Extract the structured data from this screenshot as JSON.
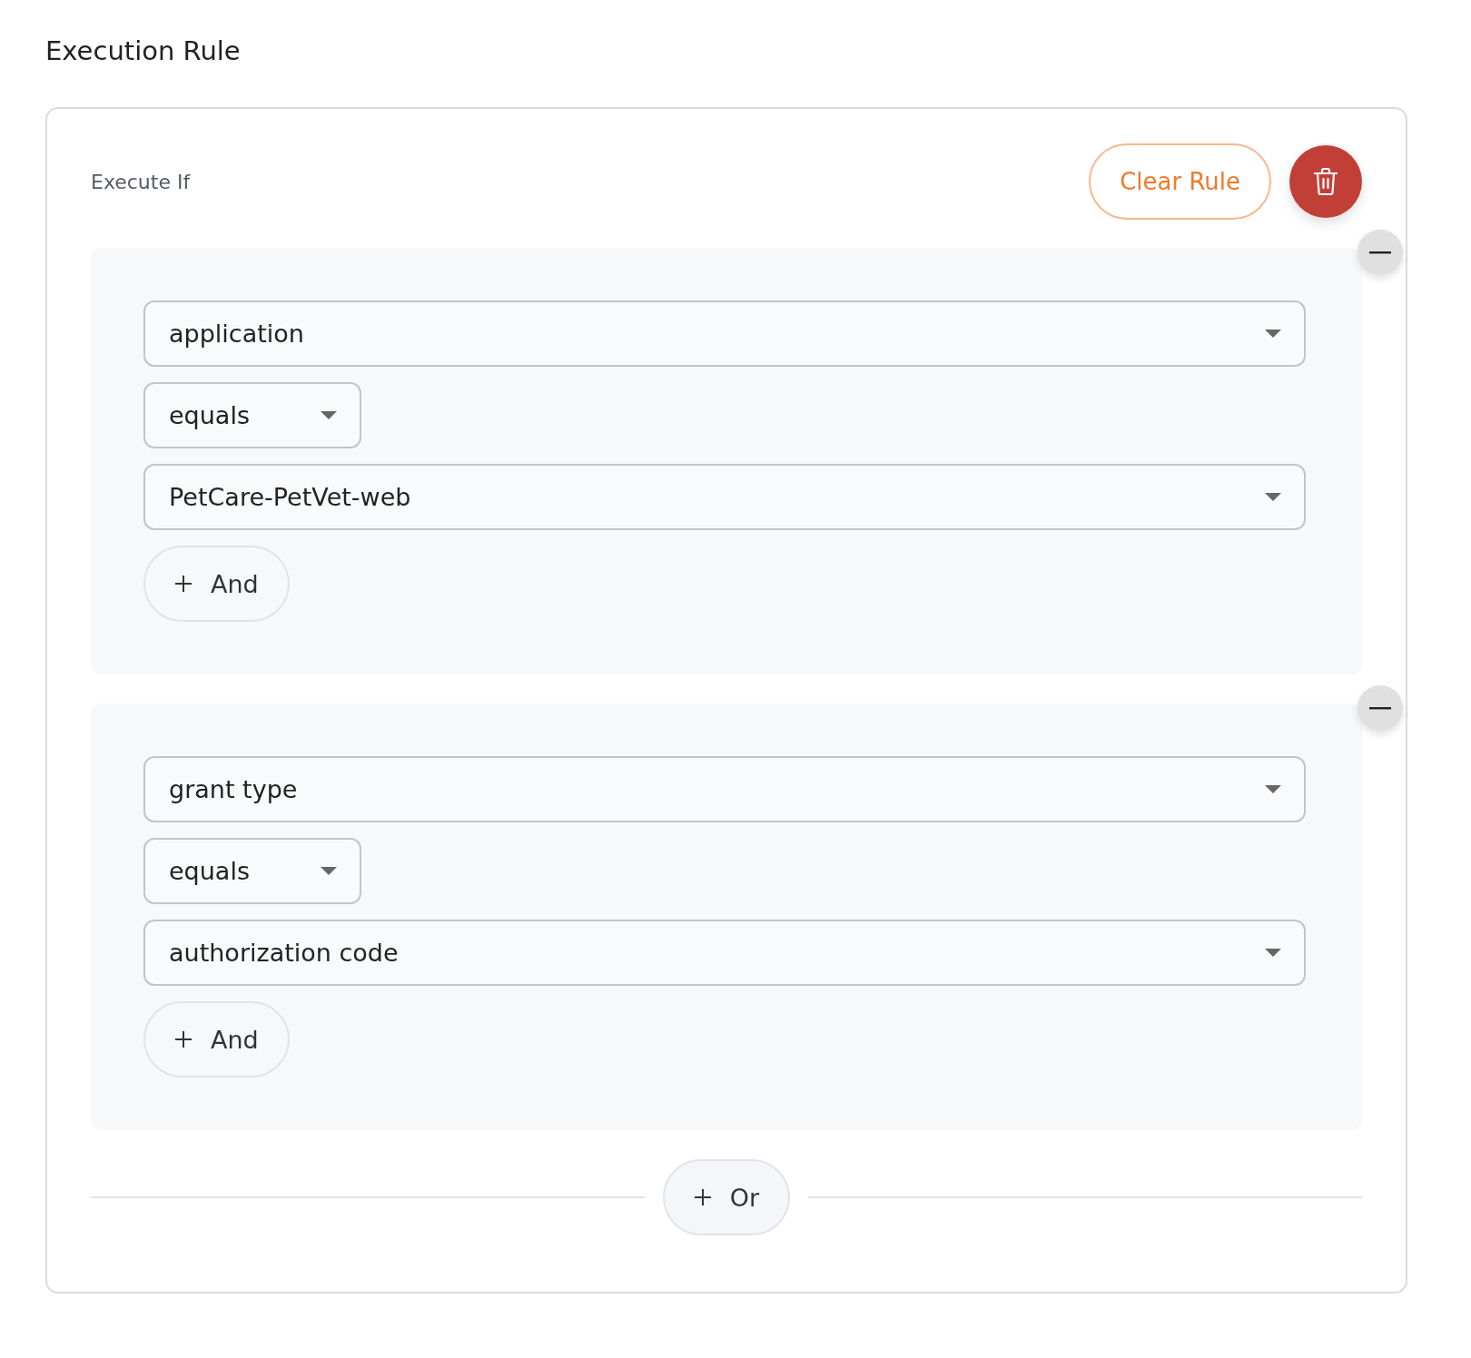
{
  "title": "Execution Rule",
  "rule": {
    "label": "Execute If",
    "clear_button": "Clear Rule",
    "groups": [
      {
        "conditions": [
          {
            "kind": "select",
            "value": "application"
          },
          {
            "kind": "operator",
            "value": "equals"
          },
          {
            "kind": "select",
            "value": "PetCare-PetVet-web"
          }
        ],
        "and_button": "And"
      },
      {
        "conditions": [
          {
            "kind": "select",
            "value": "grant type"
          },
          {
            "kind": "operator",
            "value": "equals"
          },
          {
            "kind": "select",
            "value": "authorization code"
          }
        ],
        "and_button": "And"
      }
    ],
    "or_button": "Or"
  }
}
